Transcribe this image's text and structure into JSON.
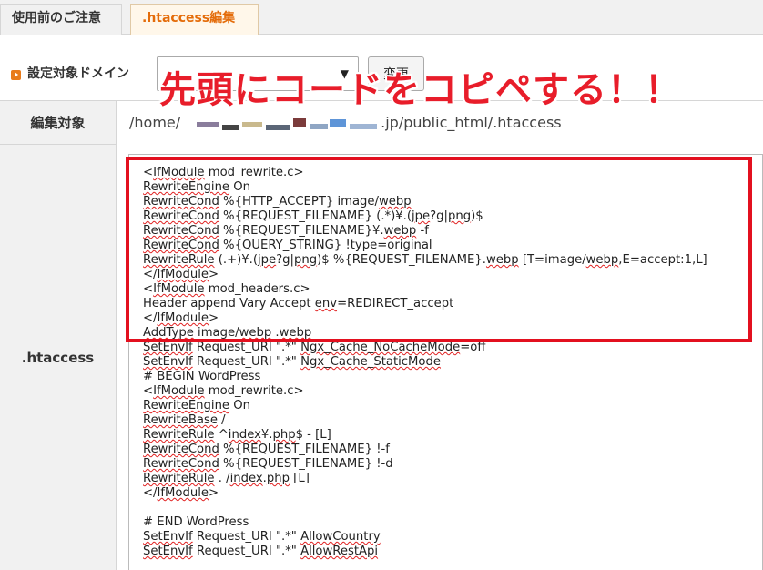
{
  "tabs": [
    {
      "label": "使用前のご注意",
      "active": false
    },
    {
      "label": ".htaccess編集",
      "active": true
    }
  ],
  "domain": {
    "label": "設定対象ドメイン",
    "select_arrow": "▼",
    "change_button": "変更"
  },
  "annotation": "先頭にコードをコピペする！！",
  "edit_target": {
    "label": "編集対象",
    "path_prefix": "/home/",
    "path_suffix": ".jp/public_html/.htaccess"
  },
  "htaccess": {
    "label": ".htaccess",
    "lines": [
      "<IfModule mod_rewrite.c>",
      "RewriteEngine On",
      "RewriteCond %{HTTP_ACCEPT} image/webp",
      "RewriteCond %{REQUEST_FILENAME} (.*)¥.(jpe?g|png)$",
      "RewriteCond %{REQUEST_FILENAME}¥.webp -f",
      "RewriteCond %{QUERY_STRING} !type=original",
      "RewriteRule (.+)¥.(jpe?g|png)$ %{REQUEST_FILENAME}.webp [T=image/webp,E=accept:1,L]",
      "</IfModule>",
      "<IfModule mod_headers.c>",
      "Header append Vary Accept env=REDIRECT_accept",
      "</IfModule>",
      "AddType image/webp .webp",
      "SetEnvIf Request_URI \".*\" Ngx_Cache_NoCacheMode=off",
      "SetEnvIf Request_URI \".*\" Ngx_Cache_StaticMode",
      "# BEGIN WordPress",
      "<IfModule mod_rewrite.c>",
      "RewriteEngine On",
      "RewriteBase /",
      "RewriteRule ^index¥.php$ - [L]",
      "RewriteCond %{REQUEST_FILENAME} !-f",
      "RewriteCond %{REQUEST_FILENAME} !-d",
      "RewriteRule . /index.php [L]",
      "</IfModule>",
      "",
      "# END WordPress",
      "SetEnvIf Request_URI \".*\" AllowCountry",
      "SetEnvIf Request_URI \".*\" AllowRestApi"
    ]
  },
  "colors": {
    "accent": "#e46c0a",
    "annotation": "#e81d2a",
    "highlight_box": "#e3101f"
  }
}
